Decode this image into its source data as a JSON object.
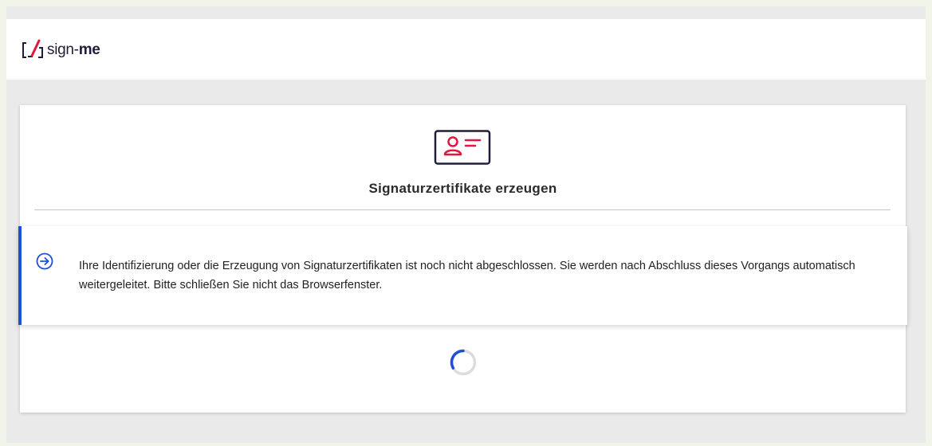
{
  "header": {
    "logo_text_regular": "sign-",
    "logo_text_bold": "me",
    "logo_icon": "sign-me-bracket-logo"
  },
  "card": {
    "icon": "id-card-icon",
    "title": "Signaturzertifikate erzeugen"
  },
  "notice": {
    "icon": "arrow-circle-right-icon",
    "message": "Ihre Identifizierung oder die Erzeugung von Signaturzertifikaten ist noch nicht abgeschlossen. Sie werden nach Abschluss dieses Vorgangs automatisch weitergeleitet. Bitte schließen Sie nicht das Browserfenster."
  },
  "loading": {
    "icon": "loading-spinner-icon"
  },
  "colors": {
    "brand_red": "#e4153f",
    "brand_navy": "#1e1e3c",
    "accent_blue": "#1e4fd6",
    "background": "#eaeaea"
  }
}
